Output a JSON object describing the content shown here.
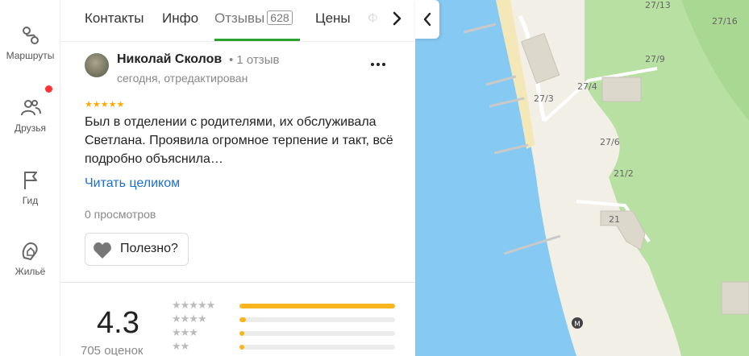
{
  "nav": {
    "items": [
      {
        "label": "Маршруты",
        "icon": "routes-icon"
      },
      {
        "label": "Друзья",
        "icon": "friends-icon"
      },
      {
        "label": "Гид",
        "icon": "guide-flag-icon"
      },
      {
        "label": "Жильё",
        "icon": "housing-icon"
      }
    ],
    "friends_has_notification": true
  },
  "tabs": {
    "items": [
      {
        "label": "Контакты"
      },
      {
        "label": "Инфо"
      },
      {
        "label": "Отзывы",
        "count": "628",
        "active": true
      },
      {
        "label": "Цены"
      },
      {
        "label": "Ф"
      }
    ]
  },
  "review": {
    "author": "Николай Сколов",
    "author_meta": "• 1 отзыв",
    "date": "сегодня, отредактирован",
    "rating": 5,
    "stars": "★★★★★",
    "text": "Был в отделении с родителями, их обслуживала Светлана. Проявила огромное терпение и такт, всё подробно объяснила…",
    "read_more": "Читать целиком",
    "views": "0 просмотров",
    "useful_label": "Полезно?"
  },
  "summary": {
    "rating": "4.3",
    "count_label": "705 оценок",
    "distribution": [
      {
        "stars": "★★★★★",
        "fraction": 1.0
      },
      {
        "stars": "★★★★",
        "fraction": 0.04
      },
      {
        "stars": "★★★",
        "fraction": 0.03
      },
      {
        "stars": "★★",
        "fraction": 0.03
      }
    ]
  },
  "map": {
    "labels": [
      "27/13",
      "27/16",
      "27/9",
      "27/4",
      "27/3",
      "27/6",
      "21/2",
      "21"
    ],
    "metro_marker": "М",
    "colors": {
      "water": "#86c9f3",
      "land": "#f2efe6",
      "park": "#b8e0a3",
      "beach": "#f4e8b8",
      "building": "#dcd8cc"
    }
  },
  "colors": {
    "accent_green": "#2aa32a",
    "link": "#1a6fd4",
    "star": "#fa0",
    "bar": "#f8b51c",
    "notification": "#f33"
  }
}
